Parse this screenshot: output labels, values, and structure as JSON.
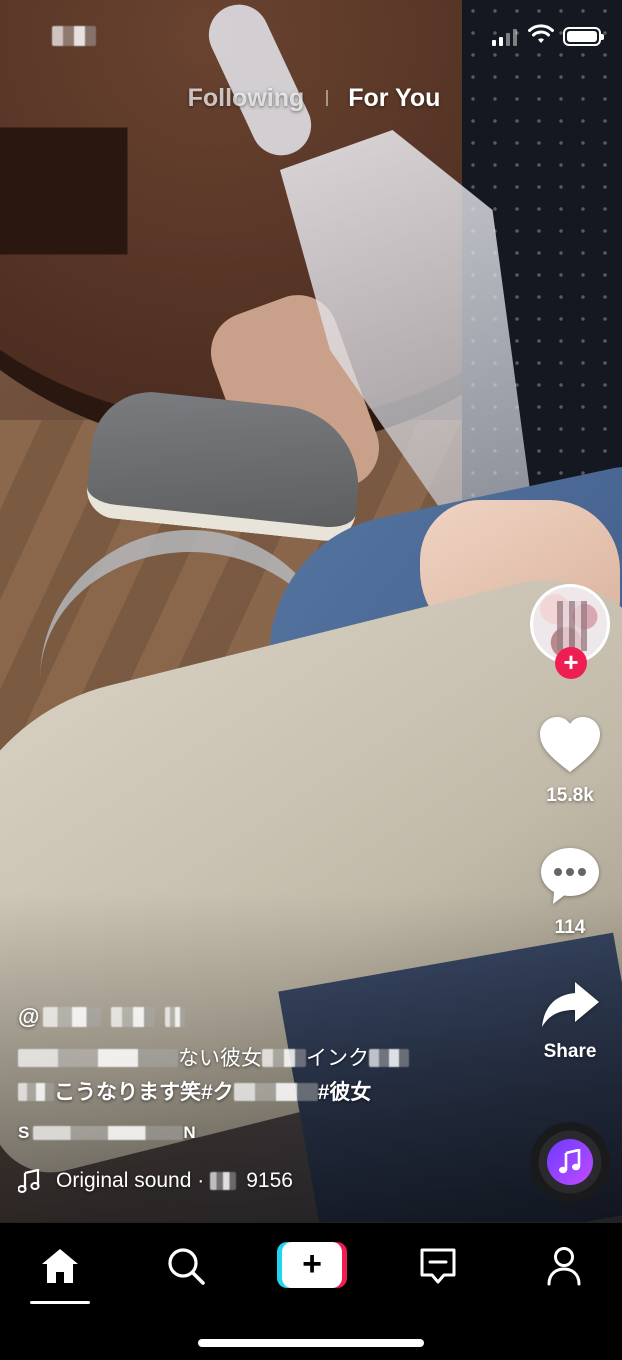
{
  "status_bar": {
    "time": "",
    "battery_level": 1.0,
    "icons": [
      "cellular-signal-icon",
      "wifi-icon",
      "battery-icon"
    ]
  },
  "top_tabs": {
    "following": "Following",
    "for_you": "For You",
    "active": "For You"
  },
  "rail": {
    "avatar_icon": "creator-avatar",
    "follow_icon": "plus-icon",
    "likes": "15.8k",
    "comments": "114",
    "share_label": "Share"
  },
  "caption": {
    "username_prefix": "@",
    "desc_line1_text_a": "ない彼女",
    "desc_line1_text_b": "インク",
    "desc_line2_text_a": "こうなります笑#ク",
    "desc_line2_text_b": "#彼女",
    "translate_prefix": "S",
    "translate_suffix": "N",
    "sound_label": "Original sound · ",
    "sound_suffix": "9156"
  },
  "nav": {
    "items": [
      "home-icon",
      "search-icon",
      "create-icon",
      "inbox-icon",
      "profile-icon"
    ],
    "active": "home"
  },
  "colors": {
    "accent_red": "#ee1d52",
    "accent_cyan": "#20d5ec",
    "music_purple": "#9b44ff"
  }
}
